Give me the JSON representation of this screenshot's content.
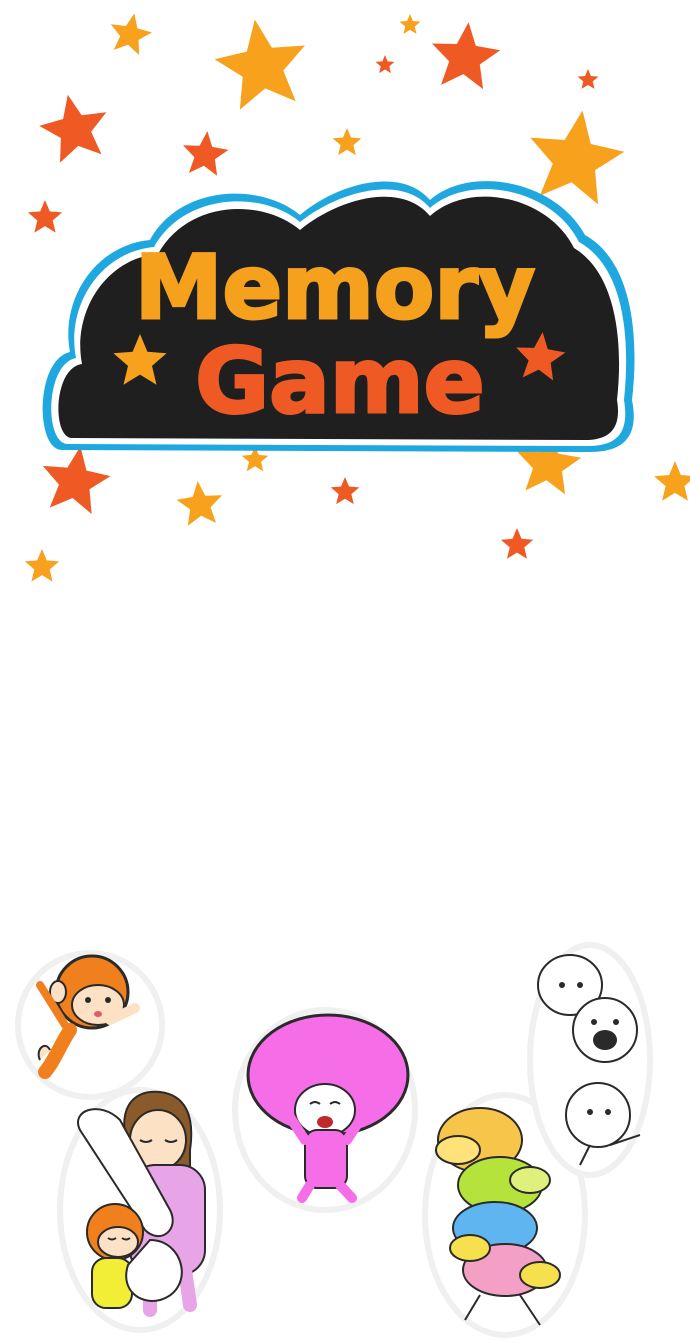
{
  "title": {
    "line1": "Memory",
    "line2": "Game"
  },
  "colors": {
    "background": "#ffffff",
    "cloud_fill": "#1f1f1f",
    "cloud_border": "#1fa7e0",
    "title_line1": "#f6a11d",
    "title_line2": "#ef5a24",
    "star_orange": "#f7a11d",
    "star_red": "#ef5a24"
  },
  "characters": [
    {
      "name": "flying-monkey",
      "icon": "monkey-flying-icon"
    },
    {
      "name": "girl-hugging-pillow-with-monkey",
      "icon": "girl-pillow-icon"
    },
    {
      "name": "pink-afro-character",
      "icon": "afro-character-icon"
    },
    {
      "name": "stacked-frogs",
      "icon": "frog-stack-icon"
    },
    {
      "name": "stacked-ghosts",
      "icon": "ghost-stack-icon"
    }
  ]
}
